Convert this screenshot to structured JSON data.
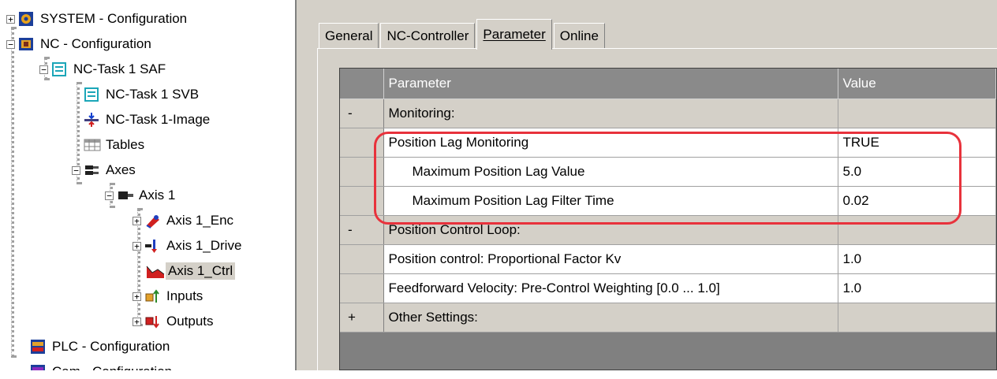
{
  "tree": {
    "items": [
      {
        "label": "SYSTEM - Configuration",
        "expander": "+",
        "icon": "system-config-icon"
      },
      {
        "label": "NC - Configuration",
        "expander": "−",
        "icon": "nc-config-icon"
      },
      {
        "label": "NC-Task 1 SAF",
        "expander": "−",
        "icon": "task-icon"
      },
      {
        "label": "NC-Task 1 SVB",
        "icon": "task-icon"
      },
      {
        "label": "NC-Task 1-Image",
        "icon": "image-icon"
      },
      {
        "label": "Tables",
        "icon": "table-icon"
      },
      {
        "label": "Axes",
        "expander": "−",
        "icon": "axes-icon"
      },
      {
        "label": "Axis 1",
        "expander": "−",
        "icon": "axis-icon"
      },
      {
        "label": "Axis 1_Enc",
        "expander": "+",
        "icon": "encoder-icon"
      },
      {
        "label": "Axis 1_Drive",
        "expander": "+",
        "icon": "drive-icon"
      },
      {
        "label": "Axis 1_Ctrl",
        "icon": "controller-icon",
        "selected": true
      },
      {
        "label": "Inputs",
        "expander": "+",
        "icon": "inputs-icon"
      },
      {
        "label": "Outputs",
        "expander": "+",
        "icon": "outputs-icon"
      },
      {
        "label": "PLC - Configuration",
        "icon": "plc-config-icon"
      },
      {
        "label": "Cam - Configuration",
        "icon": "cam-config-icon"
      }
    ]
  },
  "tabs": [
    {
      "label": "General",
      "active": false
    },
    {
      "label": "NC-Controller",
      "active": false
    },
    {
      "label": "Parameter",
      "active": true
    },
    {
      "label": "Online",
      "active": false
    }
  ],
  "grid": {
    "headers": {
      "col0": "",
      "parameter": "Parameter",
      "value": "Value"
    },
    "rows": [
      {
        "type": "group",
        "marker": "-",
        "parameter": "Monitoring:",
        "value": ""
      },
      {
        "type": "item",
        "marker": "",
        "parameter": "Position Lag Monitoring",
        "value": "TRUE",
        "indent": false
      },
      {
        "type": "item",
        "marker": "",
        "parameter": "Maximum Position Lag Value",
        "value": "5.0",
        "indent": true
      },
      {
        "type": "item",
        "marker": "",
        "parameter": "Maximum Position Lag Filter Time",
        "value": "0.02",
        "indent": true
      },
      {
        "type": "group",
        "marker": "-",
        "parameter": "Position Control Loop:",
        "value": ""
      },
      {
        "type": "item",
        "marker": "",
        "parameter": "Position control: Proportional Factor Kv",
        "value": "1.0",
        "indent": false
      },
      {
        "type": "item",
        "marker": "",
        "parameter": "Feedforward Velocity: Pre-Control Weighting [0.0 ... 1.0]",
        "value": "1.0",
        "indent": false
      },
      {
        "type": "group",
        "marker": "+",
        "parameter": "Other Settings:",
        "value": ""
      }
    ]
  },
  "colors": {
    "highlight": "#e8323c",
    "panel": "#d4d0c8",
    "grid_bg": "#808080"
  }
}
